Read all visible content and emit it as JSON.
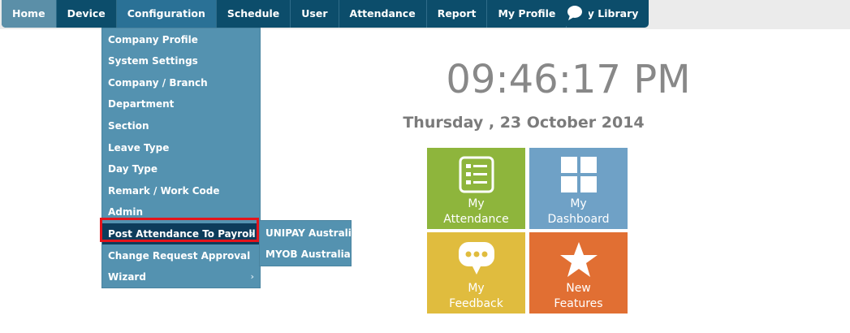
{
  "nav": {
    "items": [
      {
        "label": "Home"
      },
      {
        "label": "Device"
      },
      {
        "label": "Configuration"
      },
      {
        "label": "Schedule"
      },
      {
        "label": "User"
      },
      {
        "label": "Attendance"
      },
      {
        "label": "Report"
      },
      {
        "label": "My Profile"
      },
      {
        "label": "My Library"
      }
    ]
  },
  "config_menu": {
    "items": [
      {
        "label": "Company Profile"
      },
      {
        "label": "System Settings"
      },
      {
        "label": "Company / Branch"
      },
      {
        "label": "Department"
      },
      {
        "label": "Section"
      },
      {
        "label": "Leave Type"
      },
      {
        "label": "Day Type"
      },
      {
        "label": "Remark / Work Code"
      },
      {
        "label": "Admin"
      },
      {
        "label": "Post Attendance To Payroll",
        "arrow": "›"
      },
      {
        "label": "Change Request Approval"
      },
      {
        "label": "Wizard",
        "arrow": "›"
      }
    ]
  },
  "payroll_submenu": {
    "items": [
      {
        "label": "UNIPAY Australia"
      },
      {
        "label": "MYOB Australia"
      }
    ]
  },
  "clock": {
    "time": "09:46:17 PM",
    "date": "Thursday , 23 October 2014"
  },
  "tiles": {
    "attendance": {
      "line1": "My",
      "line2": "Attendance",
      "icon": "list-icon"
    },
    "dashboard": {
      "line1": "My",
      "line2": "Dashboard",
      "icon": "grid-icon"
    },
    "feedback": {
      "line1": "My",
      "line2": "Feedback",
      "icon": "chat-bubble-icon"
    },
    "features": {
      "line1": "New",
      "line2": "Features",
      "icon": "star-icon"
    }
  },
  "colors": {
    "nav_bg": "#0c4d6b",
    "menu_bg": "#5492b0",
    "highlight": "#e4141b",
    "tile_attendance": "#8eb53c",
    "tile_dashboard": "#6fa1c6",
    "tile_feedback": "#e0bc3e",
    "tile_features": "#e16f33"
  }
}
